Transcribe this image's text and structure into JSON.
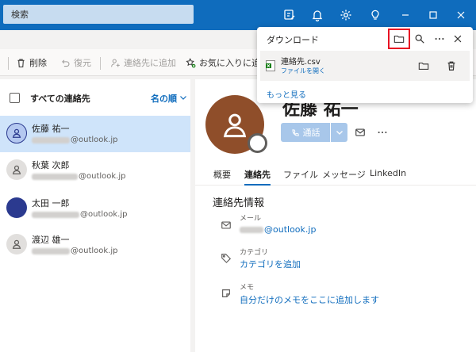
{
  "titlebar": {
    "search_placeholder": "検索"
  },
  "toolbar": {
    "delete": "削除",
    "restore": "復元",
    "add_contact": "連絡先に追加",
    "add_favorite": "お気に入りに追加"
  },
  "contacts": {
    "header": "すべての連絡先",
    "sort": "名の順",
    "items": [
      {
        "name": "佐藤 祐一",
        "email_domain": "@outlook.jp",
        "selected": true
      },
      {
        "name": "秋葉 次郎",
        "email_domain": "@outlook.jp",
        "selected": false
      },
      {
        "name": "太田 一郎",
        "email_domain": "@outlook.jp",
        "selected": false
      },
      {
        "name": "渡辺 雄一",
        "email_domain": "@outlook.jp",
        "selected": false
      }
    ]
  },
  "detail": {
    "name": "佐藤 祐一",
    "call_label": "通話",
    "tabs": [
      "概要",
      "連絡先",
      "ファイル",
      "メッセージ",
      "LinkedIn"
    ],
    "active_tab": "連絡先",
    "section_title": "連絡先情報",
    "email_label": "メール",
    "email_domain": "@outlook.jp",
    "category_label": "カテゴリ",
    "category_value": "カテゴリを追加",
    "memo_label": "メモ",
    "memo_value": "自分だけのメモをここに追加します"
  },
  "downloads": {
    "title": "ダウンロード",
    "file_name": "連絡先.csv",
    "open_file": "ファイルを開く",
    "more": "もっと見る"
  },
  "colors": {
    "accent": "#0f6cbd",
    "highlight": "#e81123",
    "avatar_brown": "#8f4e2a",
    "avatar_navy": "#2b3a8f"
  }
}
